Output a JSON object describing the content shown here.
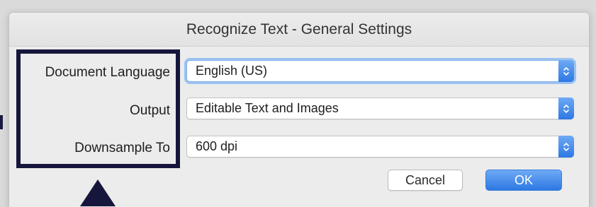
{
  "dialog": {
    "title": "Recognize Text - General Settings",
    "settings": [
      {
        "label": "Document Language",
        "value": "English (US)"
      },
      {
        "label": "Output",
        "value": "Editable Text and Images"
      },
      {
        "label": "Downsample To",
        "value": "600 dpi"
      }
    ],
    "cancel_label": "Cancel",
    "ok_label": "OK"
  },
  "icons": {
    "stepper": "up-down-chevron-icon",
    "annotation": "up-arrow-icon"
  },
  "colors": {
    "accent_blue": "#2d78e3",
    "focus_ring": "#9cc3f1",
    "annotation": "#16163d",
    "dialog_background": "#ececec"
  }
}
